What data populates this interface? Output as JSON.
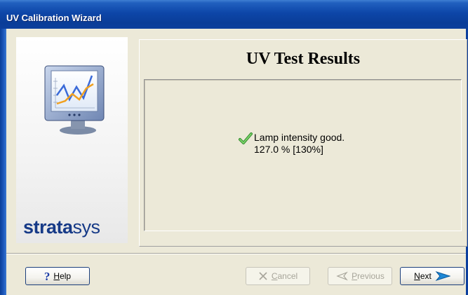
{
  "window": {
    "title": "UV Calibration Wizard"
  },
  "brand": {
    "logo_bold": "strata",
    "logo_light": "sys"
  },
  "page": {
    "heading": "UV Test Results"
  },
  "result": {
    "status": "good",
    "message": "Lamp intensity good.",
    "value": "127.0 % [130%]"
  },
  "buttons": {
    "help": "Help",
    "cancel": "Cancel",
    "previous": "Previous",
    "next": "Next"
  },
  "colors": {
    "titlebar": "#0c3f9c",
    "logo": "#163a87",
    "check": "#4caf3f",
    "next_arrow": "#1e88d6"
  },
  "icons": {
    "monitor": "chart-monitor-icon",
    "status": "checkmark-icon",
    "help": "question-icon",
    "cancel": "x-icon",
    "previous": "left-arrow-icon",
    "next": "right-arrow-icon"
  }
}
